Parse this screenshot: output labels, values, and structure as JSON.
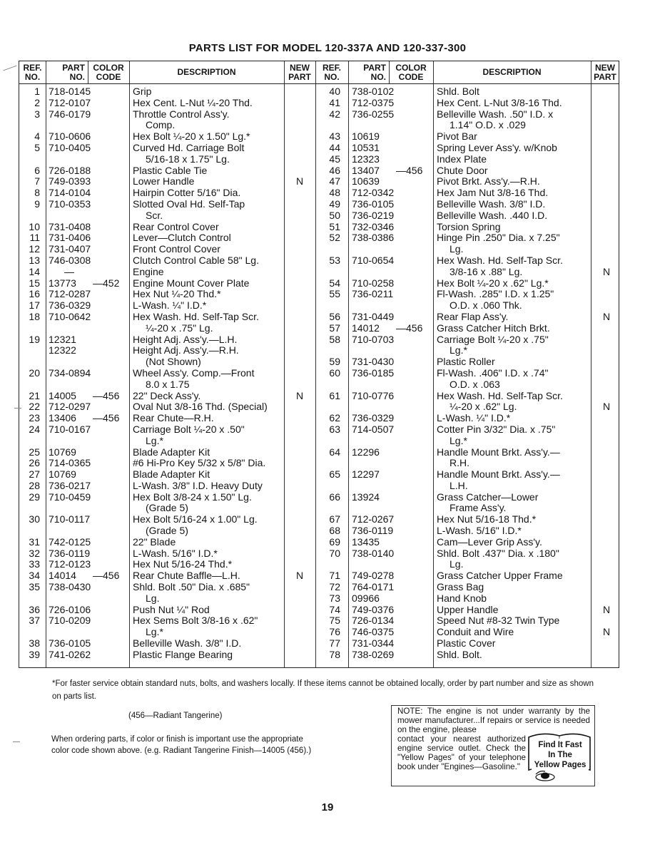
{
  "title": "PARTS LIST FOR MODEL 120-337A AND 120-337-300",
  "columns": {
    "ref_no": "REF. NO.",
    "ref_line1": "REF.",
    "ref_line2": "NO.",
    "part_line1": "PART",
    "part_line2": "NO.",
    "color_line1": "COLOR",
    "color_line2": "CODE",
    "description": "DESCRIPTION",
    "new_line1": "NEW",
    "new_line2": "PART"
  },
  "left_rows": [
    {
      "ref": "1",
      "part": "718-0145",
      "color": "",
      "desc": [
        "Grip"
      ],
      "new": "",
      "new_line": 0
    },
    {
      "ref": "2",
      "part": "712-0107",
      "color": "",
      "desc": [
        "Hex Cent. L-Nut ¼-20 Thd."
      ],
      "new": "",
      "new_line": 0
    },
    {
      "ref": "3",
      "part": "746-0179",
      "color": "",
      "desc": [
        "Throttle Control Ass'y.",
        "Comp."
      ],
      "new": "",
      "new_line": 0
    },
    {
      "ref": "4",
      "part": "710-0606",
      "color": "",
      "desc": [
        "Hex Bolt ¼-20 x 1.50\" Lg.*"
      ],
      "new": "",
      "new_line": 0
    },
    {
      "ref": "5",
      "part": "710-0405",
      "color": "",
      "desc": [
        "Curved Hd. Carriage Bolt",
        "5/16-18 x 1.75\" Lg."
      ],
      "new": "",
      "new_line": 0
    },
    {
      "ref": "6",
      "part": "726-0188",
      "color": "",
      "desc": [
        "Plastic Cable Tie"
      ],
      "new": "",
      "new_line": 0
    },
    {
      "ref": "7",
      "part": "749-0393",
      "color": "",
      "desc": [
        "Lower Handle"
      ],
      "new": "N",
      "new_line": 0
    },
    {
      "ref": "8",
      "part": "714-0104",
      "color": "",
      "desc": [
        "Hairpin Cotter 5/16\" Dia."
      ],
      "new": "",
      "new_line": 0
    },
    {
      "ref": "9",
      "part": "710-0353",
      "color": "",
      "desc": [
        "Slotted Oval Hd. Self-Tap",
        "Scr."
      ],
      "new": "",
      "new_line": 0
    },
    {
      "ref": "10",
      "part": "731-0408",
      "color": "",
      "desc": [
        "Rear Control Cover"
      ],
      "new": "",
      "new_line": 0
    },
    {
      "ref": "11",
      "part": "731-0406",
      "color": "",
      "desc": [
        "Lever—Clutch Control"
      ],
      "new": "",
      "new_line": 0
    },
    {
      "ref": "12",
      "part": "731-0407",
      "color": "",
      "desc": [
        "Front Control Cover"
      ],
      "new": "",
      "new_line": 0
    },
    {
      "ref": "13",
      "part": "746-0308",
      "color": "",
      "desc": [
        "Clutch Control Cable 58\" Lg."
      ],
      "new": "",
      "new_line": 0
    },
    {
      "ref": "14",
      "part": "—",
      "color": "",
      "desc": [
        "Engine"
      ],
      "new": "",
      "new_line": 0
    },
    {
      "ref": "15",
      "part": "13773",
      "color": "—452",
      "desc": [
        "Engine Mount Cover Plate"
      ],
      "new": "",
      "new_line": 0
    },
    {
      "ref": "16",
      "part": "712-0287",
      "color": "",
      "desc": [
        "Hex Nut ¼-20 Thd.*"
      ],
      "new": "",
      "new_line": 0
    },
    {
      "ref": "17",
      "part": "736-0329",
      "color": "",
      "desc": [
        "L-Wash. ¼\" I.D.*"
      ],
      "new": "",
      "new_line": 0
    },
    {
      "ref": "18",
      "part": "710-0642",
      "color": "",
      "desc": [
        "Hex Wash. Hd. Self-Tap Scr.",
        "¼-20 x .75\" Lg."
      ],
      "new": "",
      "new_line": 0
    },
    {
      "ref": "19",
      "part": "12321",
      "color": "",
      "desc": [
        "Height Adj. Ass'y.—L.H."
      ],
      "new": "",
      "new_line": 0
    },
    {
      "ref": "",
      "part": "12322",
      "color": "",
      "desc": [
        "Height Adj. Ass'y.—R.H.",
        "(Not Shown)"
      ],
      "new": "",
      "new_line": 0
    },
    {
      "ref": "20",
      "part": "734-0894",
      "color": "",
      "desc": [
        "Wheel Ass'y. Comp.—Front",
        "8.0 x 1.75"
      ],
      "new": "",
      "new_line": 0
    },
    {
      "ref": "21",
      "part": "14005",
      "color": "—456",
      "desc": [
        "22\" Deck Ass'y."
      ],
      "new": "N",
      "new_line": 0
    },
    {
      "ref": "22",
      "part": "712-0297",
      "color": "",
      "desc": [
        "Oval Nut 3/8-16 Thd. (Special)"
      ],
      "new": "",
      "new_line": 0
    },
    {
      "ref": "23",
      "part": "13406",
      "color": "—456",
      "desc": [
        "Rear Chute—R.H."
      ],
      "new": "",
      "new_line": 0
    },
    {
      "ref": "24",
      "part": "710-0167",
      "color": "",
      "desc": [
        "Carriage Bolt ¼-20 x .50\"",
        "Lg.*"
      ],
      "new": "",
      "new_line": 0
    },
    {
      "ref": "25",
      "part": "10769",
      "color": "",
      "desc": [
        "Blade Adapter Kit"
      ],
      "new": "",
      "new_line": 0
    },
    {
      "ref": "26",
      "part": "714-0365",
      "color": "",
      "desc": [
        "#6 Hi-Pro Key 5/32 x 5/8\" Dia."
      ],
      "new": "",
      "new_line": 0
    },
    {
      "ref": "27",
      "part": "10769",
      "color": "",
      "desc": [
        "Blade Adapter Kit"
      ],
      "new": "",
      "new_line": 0
    },
    {
      "ref": "28",
      "part": "736-0217",
      "color": "",
      "desc": [
        "L-Wash. 3/8\" I.D. Heavy Duty"
      ],
      "new": "",
      "new_line": 0
    },
    {
      "ref": "29",
      "part": "710-0459",
      "color": "",
      "desc": [
        "Hex Bolt 3/8-24 x 1.50\" Lg.",
        "(Grade 5)"
      ],
      "new": "",
      "new_line": 0
    },
    {
      "ref": "30",
      "part": "710-0117",
      "color": "",
      "desc": [
        "Hex Bolt 5/16-24 x 1.00\" Lg.",
        "(Grade 5)"
      ],
      "new": "",
      "new_line": 0
    },
    {
      "ref": "31",
      "part": "742-0125",
      "color": "",
      "desc": [
        "22\" Blade"
      ],
      "new": "",
      "new_line": 0
    },
    {
      "ref": "32",
      "part": "736-0119",
      "color": "",
      "desc": [
        "L-Wash. 5/16\" I.D.*"
      ],
      "new": "",
      "new_line": 0
    },
    {
      "ref": "33",
      "part": "712-0123",
      "color": "",
      "desc": [
        "Hex Nut 5/16-24 Thd.*"
      ],
      "new": "",
      "new_line": 0
    },
    {
      "ref": "34",
      "part": "14014",
      "color": "—456",
      "desc": [
        "Rear Chute Baffle—L.H."
      ],
      "new": "N",
      "new_line": 0
    },
    {
      "ref": "35",
      "part": "738-0430",
      "color": "",
      "desc": [
        "Shld. Bolt .50\" Dia. x .685\"",
        "Lg."
      ],
      "new": "",
      "new_line": 0
    },
    {
      "ref": "36",
      "part": "726-0106",
      "color": "",
      "desc": [
        "Push Nut ¼\" Rod"
      ],
      "new": "",
      "new_line": 0
    },
    {
      "ref": "37",
      "part": "710-0209",
      "color": "",
      "desc": [
        "Hex Sems Bolt 3/8-16 x .62\"",
        "Lg.*"
      ],
      "new": "",
      "new_line": 0
    },
    {
      "ref": "38",
      "part": "736-0105",
      "color": "",
      "desc": [
        "Belleville Wash. 3/8\" I.D."
      ],
      "new": "",
      "new_line": 0
    },
    {
      "ref": "39",
      "part": "741-0262",
      "color": "",
      "desc": [
        "Plastic Flange Bearing"
      ],
      "new": "",
      "new_line": 0
    }
  ],
  "right_rows": [
    {
      "ref": "40",
      "part": "738-0102",
      "color": "",
      "desc": [
        "Shld. Bolt"
      ],
      "new": "",
      "new_line": 0
    },
    {
      "ref": "41",
      "part": "712-0375",
      "color": "",
      "desc": [
        "Hex Cent. L-Nut 3/8-16 Thd."
      ],
      "new": "",
      "new_line": 0
    },
    {
      "ref": "42",
      "part": "736-0255",
      "color": "",
      "desc": [
        "Belleville Wash. .50\" I.D. x",
        "1.14\" O.D. x .029"
      ],
      "new": "",
      "new_line": 0
    },
    {
      "ref": "43",
      "part": "10619",
      "color": "",
      "desc": [
        "Pivot Bar"
      ],
      "new": "",
      "new_line": 0
    },
    {
      "ref": "44",
      "part": "10531",
      "color": "",
      "desc": [
        "Spring Lever Ass'y. w/Knob"
      ],
      "new": "",
      "new_line": 0
    },
    {
      "ref": "45",
      "part": "12323",
      "color": "",
      "desc": [
        "Index Plate"
      ],
      "new": "",
      "new_line": 0
    },
    {
      "ref": "46",
      "part": "13407",
      "color": "—456",
      "desc": [
        "Chute Door"
      ],
      "new": "",
      "new_line": 0
    },
    {
      "ref": "47",
      "part": "10639",
      "color": "",
      "desc": [
        "Pivot Brkt. Ass'y.—R.H."
      ],
      "new": "",
      "new_line": 0
    },
    {
      "ref": "48",
      "part": "712-0342",
      "color": "",
      "desc": [
        "Hex Jam Nut 3/8-16 Thd."
      ],
      "new": "",
      "new_line": 0
    },
    {
      "ref": "49",
      "part": "736-0105",
      "color": "",
      "desc": [
        "Belleville Wash. 3/8\" I.D."
      ],
      "new": "",
      "new_line": 0
    },
    {
      "ref": "50",
      "part": "736-0219",
      "color": "",
      "desc": [
        "Belleville Wash. .440 I.D."
      ],
      "new": "",
      "new_line": 0
    },
    {
      "ref": "51",
      "part": "732-0346",
      "color": "",
      "desc": [
        "Torsion Spring"
      ],
      "new": "",
      "new_line": 0
    },
    {
      "ref": "52",
      "part": "738-0386",
      "color": "",
      "desc": [
        "Hinge Pin .250\" Dia. x 7.25\"",
        "Lg."
      ],
      "new": "",
      "new_line": 0
    },
    {
      "ref": "53",
      "part": "710-0654",
      "color": "",
      "desc": [
        "Hex Wash. Hd. Self-Tap Scr.",
        "3/8-16 x .88\" Lg."
      ],
      "new": "N",
      "new_line": 1
    },
    {
      "ref": "54",
      "part": "710-0258",
      "color": "",
      "desc": [
        "Hex Bolt ¼-20 x .62\" Lg.*"
      ],
      "new": "",
      "new_line": 0
    },
    {
      "ref": "55",
      "part": "736-0211",
      "color": "",
      "desc": [
        "Fl-Wash. .285\" I.D. x 1.25\"",
        "O.D. x .060 Thk."
      ],
      "new": "",
      "new_line": 0
    },
    {
      "ref": "56",
      "part": "731-0449",
      "color": "",
      "desc": [
        "Rear Flap Ass'y."
      ],
      "new": "N",
      "new_line": 0
    },
    {
      "ref": "57",
      "part": "14012",
      "color": "—456",
      "desc": [
        "Grass Catcher Hitch Brkt."
      ],
      "new": "",
      "new_line": 0
    },
    {
      "ref": "58",
      "part": "710-0703",
      "color": "",
      "desc": [
        "Carriage Bolt ¼-20 x .75\"",
        "Lg.*"
      ],
      "new": "",
      "new_line": 0
    },
    {
      "ref": "59",
      "part": "731-0430",
      "color": "",
      "desc": [
        "Plastic Roller"
      ],
      "new": "",
      "new_line": 0
    },
    {
      "ref": "60",
      "part": "736-0185",
      "color": "",
      "desc": [
        "Fl-Wash. .406\" I.D. x .74\"",
        "O.D. x .063"
      ],
      "new": "",
      "new_line": 0
    },
    {
      "ref": "61",
      "part": "710-0776",
      "color": "",
      "desc": [
        "Hex Wash. Hd. Self-Tap Scr.",
        "¼-20 x .62\" Lg."
      ],
      "new": "N",
      "new_line": 1
    },
    {
      "ref": "62",
      "part": "736-0329",
      "color": "",
      "desc": [
        "L-Wash. ¼\" I.D.*"
      ],
      "new": "",
      "new_line": 0
    },
    {
      "ref": "63",
      "part": "714-0507",
      "color": "",
      "desc": [
        "Cotter Pin 3/32\" Dia. x .75\"",
        "Lg.*"
      ],
      "new": "",
      "new_line": 0
    },
    {
      "ref": "64",
      "part": "12296",
      "color": "",
      "desc": [
        "Handle Mount Brkt. Ass'y.—",
        "R.H."
      ],
      "new": "",
      "new_line": 0
    },
    {
      "ref": "65",
      "part": "12297",
      "color": "",
      "desc": [
        "Handle Mount Brkt. Ass'y.—",
        "L.H."
      ],
      "new": "",
      "new_line": 0
    },
    {
      "ref": "66",
      "part": "13924",
      "color": "",
      "desc": [
        "Grass Catcher—Lower",
        "Frame Ass'y."
      ],
      "new": "",
      "new_line": 0
    },
    {
      "ref": "67",
      "part": "712-0267",
      "color": "",
      "desc": [
        "Hex Nut 5/16-18 Thd.*"
      ],
      "new": "",
      "new_line": 0
    },
    {
      "ref": "68",
      "part": "736-0119",
      "color": "",
      "desc": [
        "L-Wash. 5/16\" I.D.*"
      ],
      "new": "",
      "new_line": 0
    },
    {
      "ref": "69",
      "part": "13435",
      "color": "",
      "desc": [
        "Cam—Lever Grip Ass'y."
      ],
      "new": "",
      "new_line": 0
    },
    {
      "ref": "70",
      "part": "738-0140",
      "color": "",
      "desc": [
        "Shld. Bolt .437\" Dia. x .180\"",
        "Lg."
      ],
      "new": "",
      "new_line": 0
    },
    {
      "ref": "71",
      "part": "749-0278",
      "color": "",
      "desc": [
        "Grass Catcher Upper Frame"
      ],
      "new": "",
      "new_line": 0
    },
    {
      "ref": "72",
      "part": "764-0171",
      "color": "",
      "desc": [
        "Grass Bag"
      ],
      "new": "",
      "new_line": 0
    },
    {
      "ref": "73",
      "part": "09966",
      "color": "",
      "desc": [
        "Hand Knob"
      ],
      "new": "",
      "new_line": 0
    },
    {
      "ref": "74",
      "part": "749-0376",
      "color": "",
      "desc": [
        "Upper Handle"
      ],
      "new": "N",
      "new_line": 0
    },
    {
      "ref": "75",
      "part": "726-0134",
      "color": "",
      "desc": [
        "Speed Nut #8-32 Twin Type"
      ],
      "new": "",
      "new_line": 0
    },
    {
      "ref": "76",
      "part": "746-0375",
      "color": "",
      "desc": [
        "Conduit and Wire"
      ],
      "new": "N",
      "new_line": 0
    },
    {
      "ref": "77",
      "part": "731-0344",
      "color": "",
      "desc": [
        "Plastic Cover"
      ],
      "new": "",
      "new_line": 0
    },
    {
      "ref": "78",
      "part": "738-0269",
      "color": "",
      "desc": [
        "Shld. Bolt."
      ],
      "new": "",
      "new_line": 0
    }
  ],
  "footnote": "*For faster service obtain standard nuts, bolts, and washers locally. If these items cannot be obtained locally, order by part number and size as shown on parts list.",
  "color_legend": "(456—Radiant Tangerine)",
  "order_note": "When ordering parts, if color or finish is important use the appropriate color code shown above. (e.g. Radiant Tangerine Finish—14005 (456).)",
  "engine_note": {
    "top": "NOTE: The engine is not under warranty by the mower manufacturer...If repairs or service is needed on the engine, please",
    "left": "contact your nearest authorized engine service outlet. Check the \"Yellow Pages\" of your telephone book under \"Engines—Gasoline.\"",
    "badge_line1": "Find It Fast",
    "badge_line2": "In The",
    "badge_line3": "Yellow Pages",
    "badge_icon": "telephone-icon"
  },
  "page_number": "19"
}
